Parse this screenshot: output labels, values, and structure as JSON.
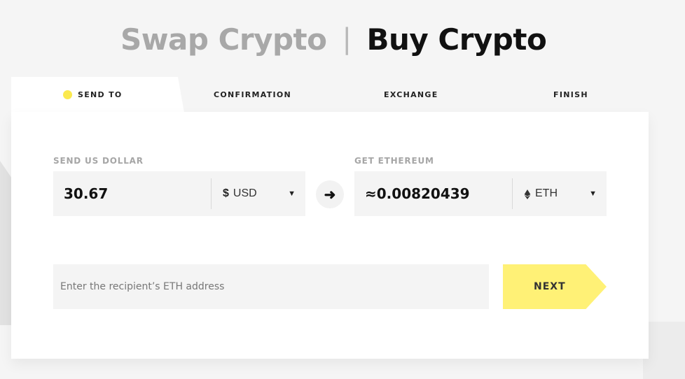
{
  "header": {
    "swap_label": "Swap Crypto",
    "separator": "|",
    "buy_label": "Buy Crypto"
  },
  "steps": [
    {
      "label": "SEND TO",
      "active": true
    },
    {
      "label": "CONFIRMATION",
      "active": false
    },
    {
      "label": "EXCHANGE",
      "active": false
    },
    {
      "label": "FINISH",
      "active": false
    }
  ],
  "send": {
    "label": "SEND US DOLLAR",
    "amount": "30.67",
    "currency_symbol": "$",
    "currency_code": "USD",
    "caret": "▼"
  },
  "swap_arrow": "➜",
  "get": {
    "label": "GET ETHEREUM",
    "amount": "≈0.00820439",
    "currency_icon": "eth-icon",
    "currency_code": "ETH",
    "caret": "▼"
  },
  "address": {
    "placeholder": "Enter the recipient’s ETH address",
    "value": ""
  },
  "next_label": "NEXT",
  "colors": {
    "accent_yellow": "#fff176",
    "active_dot": "#fbe94e",
    "page_bg": "#f5f5f5"
  }
}
